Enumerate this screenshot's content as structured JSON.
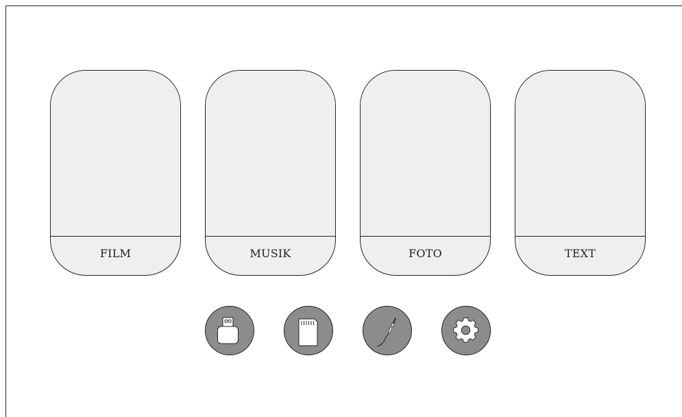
{
  "menu": {
    "cards": [
      {
        "label": "FILM"
      },
      {
        "label": "MUSIK"
      },
      {
        "label": "FOTO"
      },
      {
        "label": "TEXT"
      }
    ]
  },
  "sources": [
    {
      "icon": "usb-drive-icon"
    },
    {
      "icon": "sd-card-icon"
    },
    {
      "icon": "audio-jack-icon"
    },
    {
      "icon": "gear-icon"
    }
  ],
  "colors": {
    "card_fill": "#efefef",
    "icon_button_fill": "#8c8c8c",
    "outline": "#222222",
    "icon_fill": "#ffffff"
  }
}
